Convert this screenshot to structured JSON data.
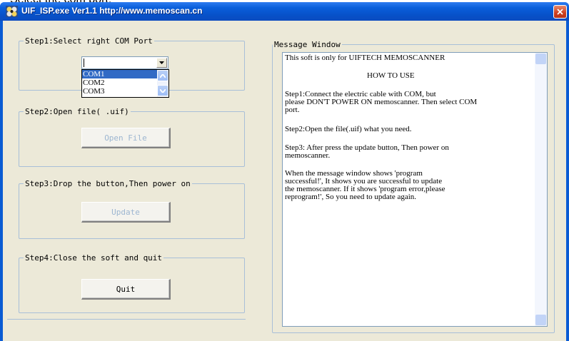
{
  "document": {
    "clipped_text": "Select the com port."
  },
  "window": {
    "title": "UIF_ISP.exe  Ver1.1  http://www.memoscan.cn"
  },
  "step1": {
    "legend": "Step1:Select right COM Port",
    "combo_value": "",
    "options": [
      "COM1",
      "COM2",
      "COM3"
    ],
    "selected_index": 0
  },
  "step2": {
    "legend": "Step2:Open file( .uif)",
    "button": "Open File",
    "button_enabled": false
  },
  "step3": {
    "legend": "Step3:Drop the button,Then power on",
    "button": "Update",
    "button_enabled": false
  },
  "step4": {
    "legend": "Step4:Close the soft and quit",
    "button": "Quit",
    "button_enabled": true
  },
  "message_window": {
    "legend": "Message Window",
    "lines": [
      "This soft is only for UIFTECH MEMOSCANNER",
      "HOW TO USE",
      "Step1:Connect the electric cable with COM, but",
      "please DON'T POWER ON memoscanner. Then select COM",
      "port.",
      "Step2:Open the file(.uif) what you need.",
      "Step3: After press the update button, Then power on",
      "memoscanner.",
      "When the message window shows 'program",
      "successful!', It shows you are successful to update",
      "the memoscanner. If it shows 'program error,please",
      "reprogram!', So you need to update again."
    ]
  },
  "colors": {
    "titlebar": "#0a5fdb",
    "client_bg": "#ece9d8",
    "selection": "#316ac5",
    "disabled_text": "#9db6d1"
  }
}
